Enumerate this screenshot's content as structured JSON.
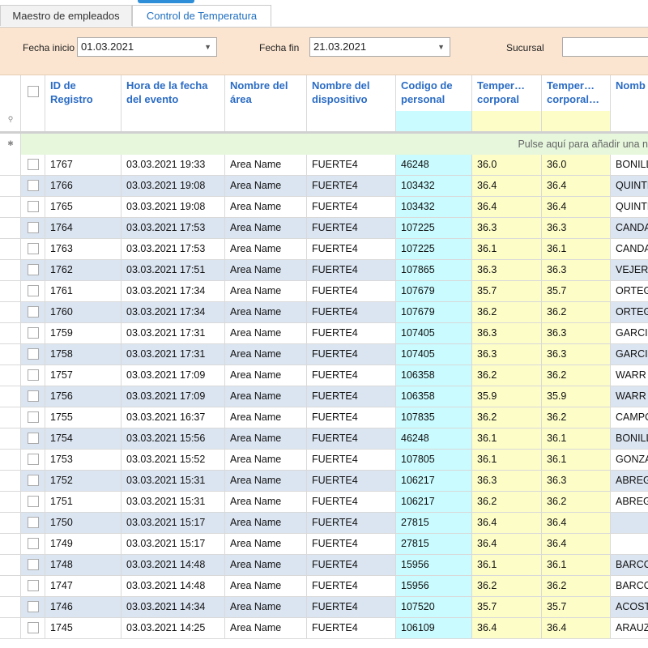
{
  "tabs": [
    {
      "label": "Maestro de empleados"
    },
    {
      "label": "Control de Temperatura"
    }
  ],
  "filters": {
    "fecha_inicio_label": "Fecha inicio",
    "fecha_inicio_value": "01.03.2021",
    "fecha_fin_label": "Fecha fin",
    "fecha_fin_value": "21.03.2021",
    "sucursal_label": "Sucursal",
    "sucursal_value": ""
  },
  "columns": [
    "ID de Registro",
    "Hora de la fecha del evento",
    "Nombre del área",
    "Nombre del dispositivo",
    "Codigo de personal",
    "Temper… corporal",
    "Temper… corporal…",
    "Nomb"
  ],
  "new_row_text": "Pulse aquí para añadir una n",
  "icons": {
    "filter_row": "filter-pin-icon",
    "new_row": "asterisk-icon",
    "dropdown": "chevron-down-icon"
  },
  "colors": {
    "accent": "#2b6cc4",
    "filter_bg": "#fbe5d0",
    "code_col": "#c9fbff",
    "temp_col": "#fdfdc8",
    "alt_row": "#dbe5f1"
  },
  "rows": [
    {
      "id": "1767",
      "time": "03.03.2021 19:33",
      "area": "Area Name",
      "device": "FUERTE4",
      "code": "46248",
      "t1": "36.0",
      "t2": "36.0",
      "name": "BONILL"
    },
    {
      "id": "1766",
      "time": "03.03.2021 19:08",
      "area": "Area Name",
      "device": "FUERTE4",
      "code": "103432",
      "t1": "36.4",
      "t2": "36.4",
      "name": "QUINTE"
    },
    {
      "id": "1765",
      "time": "03.03.2021 19:08",
      "area": "Area Name",
      "device": "FUERTE4",
      "code": "103432",
      "t1": "36.4",
      "t2": "36.4",
      "name": "QUINTE"
    },
    {
      "id": "1764",
      "time": "03.03.2021 17:53",
      "area": "Area Name",
      "device": "FUERTE4",
      "code": "107225",
      "t1": "36.3",
      "t2": "36.3",
      "name": "CANDA"
    },
    {
      "id": "1763",
      "time": "03.03.2021 17:53",
      "area": "Area Name",
      "device": "FUERTE4",
      "code": "107225",
      "t1": "36.1",
      "t2": "36.1",
      "name": "CANDA"
    },
    {
      "id": "1762",
      "time": "03.03.2021 17:51",
      "area": "Area Name",
      "device": "FUERTE4",
      "code": "107865",
      "t1": "36.3",
      "t2": "36.3",
      "name": "VEJER"
    },
    {
      "id": "1761",
      "time": "03.03.2021 17:34",
      "area": "Area Name",
      "device": "FUERTE4",
      "code": "107679",
      "t1": "35.7",
      "t2": "35.7",
      "name": "ORTEG"
    },
    {
      "id": "1760",
      "time": "03.03.2021 17:34",
      "area": "Area Name",
      "device": "FUERTE4",
      "code": "107679",
      "t1": "36.2",
      "t2": "36.2",
      "name": "ORTEG"
    },
    {
      "id": "1759",
      "time": "03.03.2021 17:31",
      "area": "Area Name",
      "device": "FUERTE4",
      "code": "107405",
      "t1": "36.3",
      "t2": "36.3",
      "name": "GARCI"
    },
    {
      "id": "1758",
      "time": "03.03.2021 17:31",
      "area": "Area Name",
      "device": "FUERTE4",
      "code": "107405",
      "t1": "36.3",
      "t2": "36.3",
      "name": "GARCI"
    },
    {
      "id": "1757",
      "time": "03.03.2021 17:09",
      "area": "Area Name",
      "device": "FUERTE4",
      "code": "106358",
      "t1": "36.2",
      "t2": "36.2",
      "name": "WARR"
    },
    {
      "id": "1756",
      "time": "03.03.2021 17:09",
      "area": "Area Name",
      "device": "FUERTE4",
      "code": "106358",
      "t1": "35.9",
      "t2": "35.9",
      "name": "WARR"
    },
    {
      "id": "1755",
      "time": "03.03.2021 16:37",
      "area": "Area Name",
      "device": "FUERTE4",
      "code": "107835",
      "t1": "36.2",
      "t2": "36.2",
      "name": "CAMPO"
    },
    {
      "id": "1754",
      "time": "03.03.2021 15:56",
      "area": "Area Name",
      "device": "FUERTE4",
      "code": "46248",
      "t1": "36.1",
      "t2": "36.1",
      "name": "BONILL"
    },
    {
      "id": "1753",
      "time": "03.03.2021 15:52",
      "area": "Area Name",
      "device": "FUERTE4",
      "code": "107805",
      "t1": "36.1",
      "t2": "36.1",
      "name": "GONZA"
    },
    {
      "id": "1752",
      "time": "03.03.2021 15:31",
      "area": "Area Name",
      "device": "FUERTE4",
      "code": "106217",
      "t1": "36.3",
      "t2": "36.3",
      "name": "ABREG"
    },
    {
      "id": "1751",
      "time": "03.03.2021 15:31",
      "area": "Area Name",
      "device": "FUERTE4",
      "code": "106217",
      "t1": "36.2",
      "t2": "36.2",
      "name": "ABREG"
    },
    {
      "id": "1750",
      "time": "03.03.2021 15:17",
      "area": "Area Name",
      "device": "FUERTE4",
      "code": "27815",
      "t1": "36.4",
      "t2": "36.4",
      "name": ""
    },
    {
      "id": "1749",
      "time": "03.03.2021 15:17",
      "area": "Area Name",
      "device": "FUERTE4",
      "code": "27815",
      "t1": "36.4",
      "t2": "36.4",
      "name": ""
    },
    {
      "id": "1748",
      "time": "03.03.2021 14:48",
      "area": "Area Name",
      "device": "FUERTE4",
      "code": "15956",
      "t1": "36.1",
      "t2": "36.1",
      "name": "BARCO"
    },
    {
      "id": "1747",
      "time": "03.03.2021 14:48",
      "area": "Area Name",
      "device": "FUERTE4",
      "code": "15956",
      "t1": "36.2",
      "t2": "36.2",
      "name": "BARCO"
    },
    {
      "id": "1746",
      "time": "03.03.2021 14:34",
      "area": "Area Name",
      "device": "FUERTE4",
      "code": "107520",
      "t1": "35.7",
      "t2": "35.7",
      "name": "ACOST"
    },
    {
      "id": "1745",
      "time": "03.03.2021 14:25",
      "area": "Area Name",
      "device": "FUERTE4",
      "code": "106109",
      "t1": "36.4",
      "t2": "36.4",
      "name": "ARAUZ"
    }
  ]
}
